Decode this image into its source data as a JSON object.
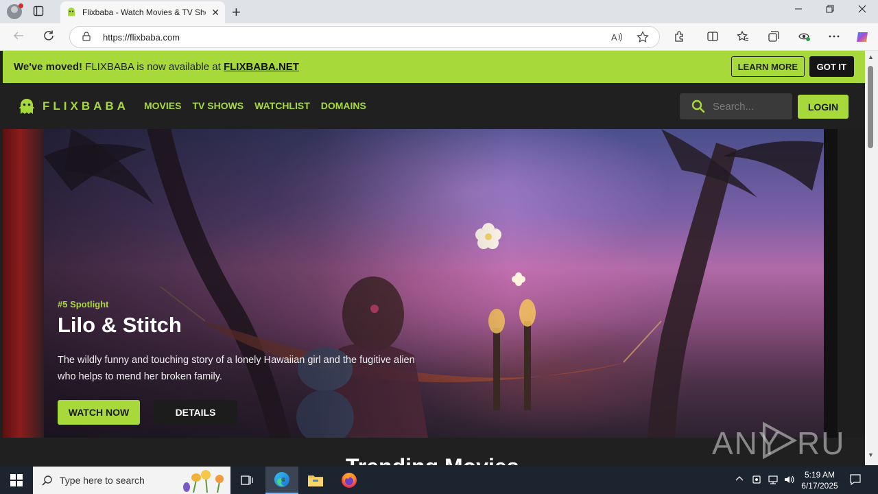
{
  "browser": {
    "tab_title": "Flixbaba - Watch Movies & TV Shows",
    "url": "https://flixbaba.com",
    "new_tab_glyph": "+",
    "close_glyph": "✕"
  },
  "announcement": {
    "lead": "We've moved!",
    "text": " FLIXBABA is now available at ",
    "link": "FLIXBABA.NET",
    "learn_more": "LEARN MORE",
    "got_it": "GOT IT"
  },
  "site": {
    "logo_text": "FLIXBABA",
    "nav": [
      "MOVIES",
      "TV SHOWS",
      "WATCHLIST",
      "DOMAINS"
    ],
    "search_placeholder": "Search...",
    "login": "LOGIN",
    "accent_color": "#a8d93a"
  },
  "hero": {
    "spotlight": "#5 Spotlight",
    "title": "Lilo & Stitch",
    "description": "The wildly funny and touching story of a lonely Hawaiian girl and the fugitive alien who helps to mend her broken family.",
    "watch_now": "WATCH NOW",
    "details": "DETAILS"
  },
  "section": {
    "title": "Trending Movies"
  },
  "watermark": "ANY RUN",
  "taskbar": {
    "search_placeholder": "Type here to search",
    "time": "5:19 AM",
    "date": "6/17/2025"
  }
}
